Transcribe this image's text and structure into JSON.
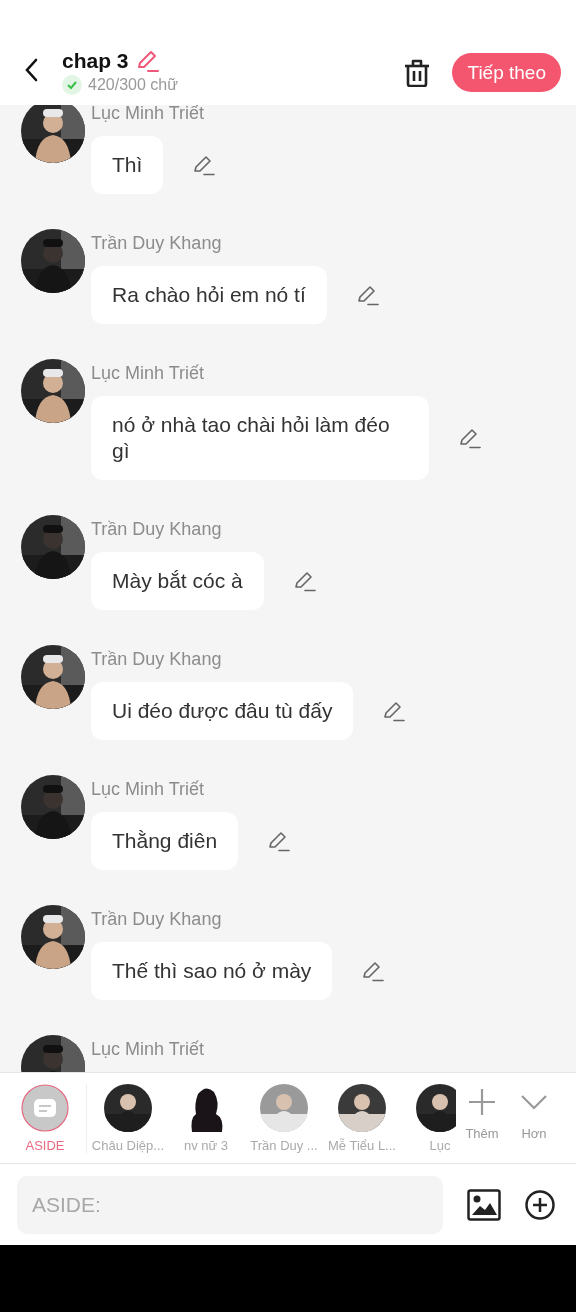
{
  "header": {
    "title": "chap 3",
    "word_count": "420/300 chữ",
    "word_count_ok": true,
    "next_button": "Tiếp theo"
  },
  "messages": [
    {
      "speaker": "Lục Minh Triết",
      "text": "Thì"
    },
    {
      "speaker": "Trần Duy Khang",
      "text": "Ra chào hỏi em nó tí"
    },
    {
      "speaker": "Lục Minh Triết",
      "text": "nó ở nhà tao chài hỏi làm đéo gì"
    },
    {
      "speaker": "Trần Duy Khang",
      "text": "Mày bắt cóc à"
    },
    {
      "speaker": "Trần Duy Khang",
      "text": "Ui đéo được đâu tù đấy"
    },
    {
      "speaker": "Lục Minh Triết",
      "text": "Thằng điên"
    },
    {
      "speaker": "Trần Duy Khang",
      "text": "Thế thì sao nó ở mày"
    },
    {
      "speaker": "Lục Minh Triết"
    }
  ],
  "characters": [
    {
      "kind": "aside",
      "label": "ASIDE",
      "selected": true
    },
    {
      "kind": "picture",
      "label": "Châu Diệp...",
      "selected": false
    },
    {
      "kind": "silhouette",
      "label": "nv nữ 3",
      "selected": false
    },
    {
      "kind": "picture",
      "label": "Trần Duy ...",
      "selected": false
    },
    {
      "kind": "picture",
      "label": "Mễ Tiểu L...",
      "selected": false
    },
    {
      "kind": "picture",
      "label": "Lục",
      "selected": false
    }
  ],
  "add_button": "Thêm",
  "more_button": "Hơn",
  "composer": {
    "placeholder": "ASIDE:"
  }
}
